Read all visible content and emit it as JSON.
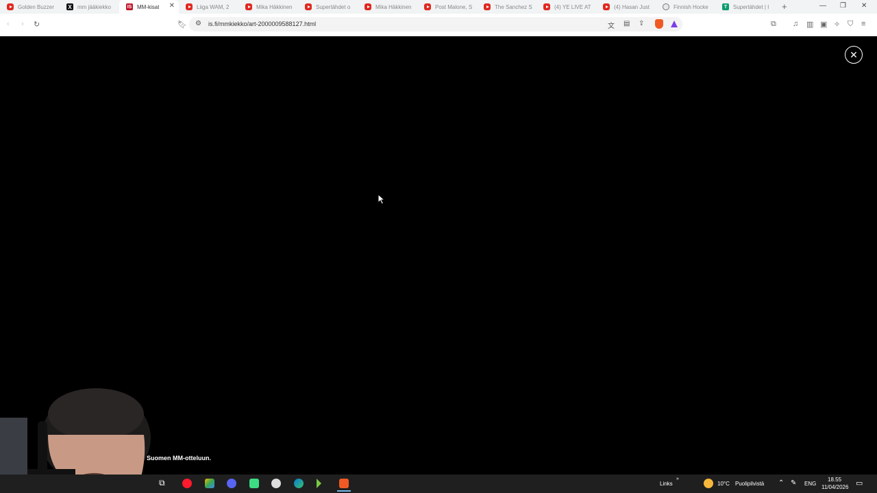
{
  "tabs": [
    {
      "title": "Golden Buzzer",
      "icon": "yt",
      "active": false
    },
    {
      "title": "mm jääkiekko",
      "icon": "x",
      "active": false
    },
    {
      "title": "MM-kisat",
      "icon": "is",
      "active": true
    },
    {
      "title": "Liiga WAM, 2",
      "icon": "yt",
      "active": false
    },
    {
      "title": "Mika Häkkinen",
      "icon": "yt",
      "active": false
    },
    {
      "title": "Supertähdet o",
      "icon": "yt",
      "active": false
    },
    {
      "title": "Mika Häkkinen",
      "icon": "yt",
      "active": false
    },
    {
      "title": "Post Malone, S",
      "icon": "yt",
      "active": false
    },
    {
      "title": "The Sanchez S",
      "icon": "yt",
      "active": false
    },
    {
      "title": "(4) YE LIVE AT",
      "icon": "yt",
      "active": false
    },
    {
      "title": "(4) Hasan Just",
      "icon": "yt",
      "active": false
    },
    {
      "title": "Finnish Hocke",
      "icon": "pr",
      "active": false
    },
    {
      "title": "Supertähdet | I",
      "icon": "gr",
      "active": false
    }
  ],
  "toolbar": {
    "url": "is.fi/mmkiekko/art-2000009588127.html"
  },
  "webcam": {
    "caption": "Suomen MM-otteluun."
  },
  "taskbar": {
    "links_label": "Links",
    "weather_temp": "10°C",
    "weather_desc": "Puolipilvistä",
    "language": "ENG",
    "time": "18.55",
    "date": "11/04/2026"
  }
}
